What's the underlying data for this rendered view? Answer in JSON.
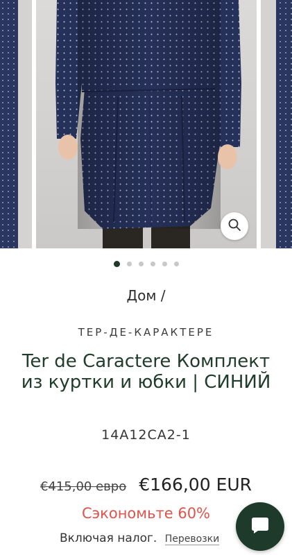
{
  "gallery": {
    "image_alt": "model wearing navy polka-dot jacket and skirt",
    "slide_count": 6,
    "active_slide": 1,
    "zoom_icon": "search-icon"
  },
  "breadcrumb": {
    "home": "Дом /"
  },
  "product": {
    "brand": "ТЕР-ДЕ-КАРАКТЕРЕ",
    "title": "Ter de Caractere Комплект из куртки и юбки | СИНИЙ",
    "sku": "14A12CA2-1",
    "old_price": "€415,00 евро",
    "price": "€166,00 EUR",
    "discount": "Сэкономьте 60%",
    "tax_note": "Включая налог.",
    "shipping_link": "Перевозки"
  },
  "chat": {
    "icon": "chat-icon"
  },
  "colors": {
    "accent_green": "#1d3a2a",
    "discount_red": "#e0534a",
    "fabric_navy": "#27325a"
  }
}
